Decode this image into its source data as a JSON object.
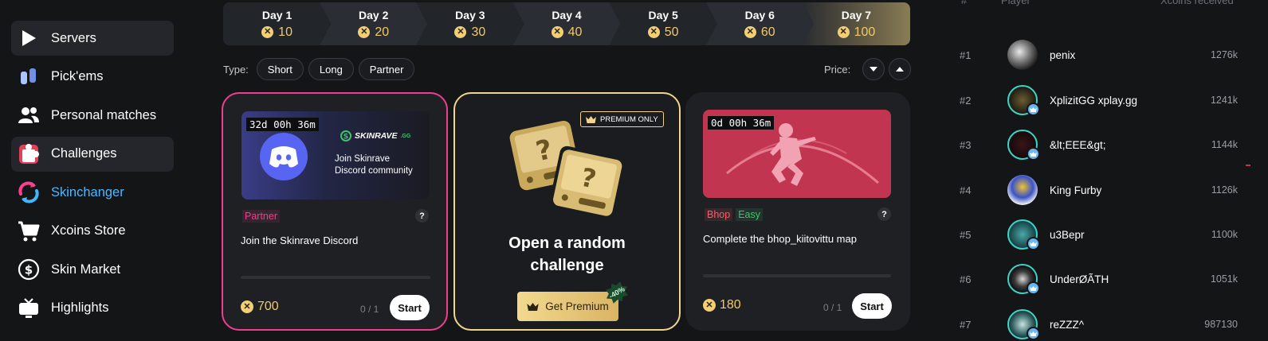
{
  "sidebar": {
    "items": [
      {
        "label": "Servers",
        "icon": "play-icon"
      },
      {
        "label": "Pick'ems",
        "icon": "pickems-icon"
      },
      {
        "label": "Personal matches",
        "icon": "users-icon"
      },
      {
        "label": "Challenges",
        "icon": "puzzle-icon"
      },
      {
        "label": "Skinchanger",
        "icon": "skinchanger-icon"
      },
      {
        "label": "Xcoins Store",
        "icon": "cart-icon"
      },
      {
        "label": "Skin Market",
        "icon": "dollar-icon"
      },
      {
        "label": "Highlights",
        "icon": "tv-icon"
      }
    ],
    "active": "Challenges"
  },
  "days": [
    {
      "label": "Day 1",
      "reward": "10"
    },
    {
      "label": "Day 2",
      "reward": "20"
    },
    {
      "label": "Day 3",
      "reward": "30"
    },
    {
      "label": "Day 4",
      "reward": "40"
    },
    {
      "label": "Day 5",
      "reward": "50"
    },
    {
      "label": "Day 6",
      "reward": "60"
    },
    {
      "label": "Day 7",
      "reward": "100"
    }
  ],
  "filters": {
    "type_label": "Type:",
    "types": [
      "Short",
      "Long",
      "Partner"
    ],
    "price_label": "Price:"
  },
  "cards": [
    {
      "timer": "32d 00h 36m",
      "brand": "SKINRAVE",
      "brand_suffix": ".GG",
      "promo_line1": "Join Skinrave",
      "promo_line2": "Discord community",
      "tags": [
        "Partner"
      ],
      "title": "Join the Skinrave Discord",
      "reward": "700",
      "progress": "0 / 1",
      "button": "Start"
    },
    {
      "badge": "PREMIUM ONLY",
      "title_line1": "Open a random",
      "title_line2": "challenge",
      "button": "Get Premium",
      "discount": "-40%"
    },
    {
      "timer": "0d 00h 36m",
      "tags": [
        "Bhop",
        "Easy"
      ],
      "title": "Complete the bhop_kiitovittu map",
      "reward": "180",
      "progress": "0 / 1",
      "button": "Start"
    }
  ],
  "leaderboard": {
    "headers": [
      "#",
      "Player",
      "Xcoins received"
    ],
    "rows": [
      {
        "rank": "#1",
        "name": "penix",
        "value": "1276k"
      },
      {
        "rank": "#2",
        "name": "XplizitGG xplay.gg",
        "value": "1241k"
      },
      {
        "rank": "#3",
        "name": "&lt;EEE&gt;",
        "value": "1144k"
      },
      {
        "rank": "#4",
        "name": "King Furby",
        "value": "1126k"
      },
      {
        "rank": "#5",
        "name": "u3Bepr",
        "value": "1100k"
      },
      {
        "rank": "#6",
        "name": "UnderØÃTH",
        "value": "1051k"
      },
      {
        "rank": "#7",
        "name": "reZZZ^",
        "value": "987130"
      }
    ]
  },
  "colors": {
    "accent_gold": "#f0c96a",
    "partner_pink": "#ef3e8f",
    "active_bg": "#24262b",
    "bhop_red": "#c23550"
  }
}
